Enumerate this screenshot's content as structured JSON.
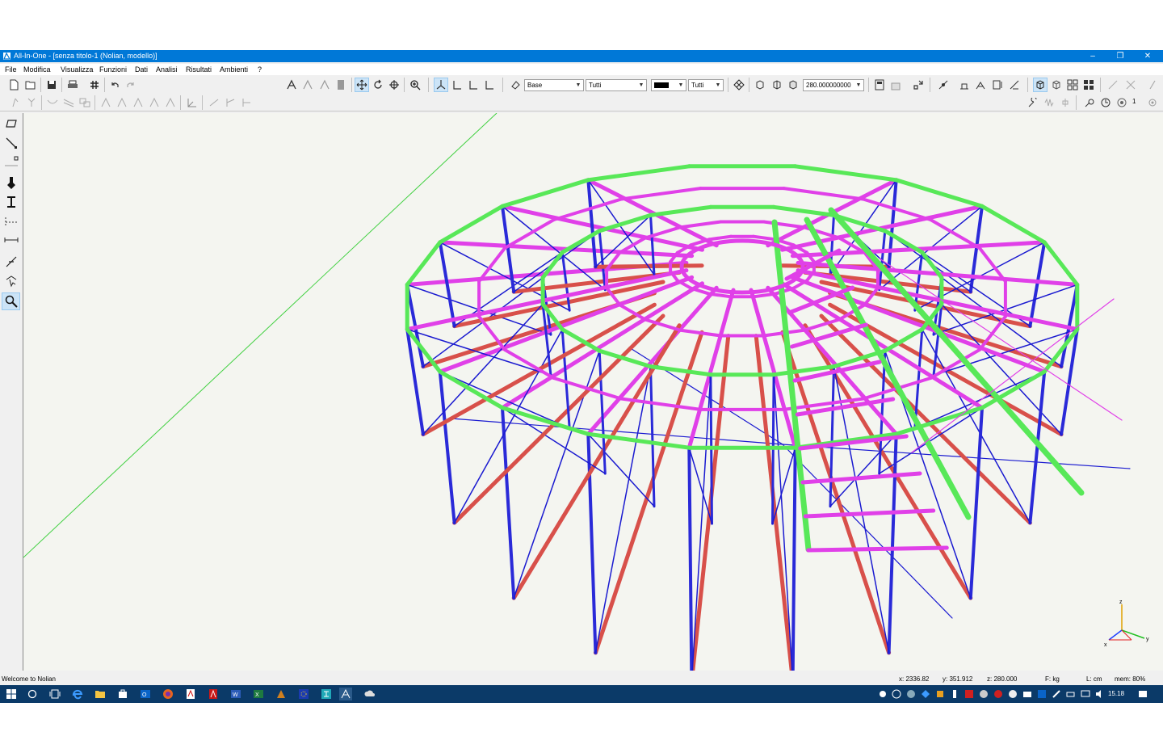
{
  "window": {
    "title": "All-In-One - [senza titolo-1 (Nolian, modello)]",
    "minimize": "‒",
    "restore": "❐",
    "close": "✕"
  },
  "menu": [
    "File",
    "Modifica",
    "Visualizza",
    "Funzioni",
    "Dati",
    "Analisi",
    "Risultati",
    "Ambienti",
    "?"
  ],
  "toolbar": {
    "layer_select": "Base",
    "filter_select": "Tutti",
    "color_select": "",
    "filter2_select": "Tutti",
    "number_field": "280.000000000",
    "layer_count": "1"
  },
  "colors": {
    "titlebar": "#0078d7",
    "taskbar": "#0b3a68",
    "member_magenta": "#e040e8",
    "member_blue": "#2a2ad8",
    "member_red": "#d8504a",
    "member_green": "#58e858",
    "bracing_blue": "#1a1ad0",
    "guide_line": "#40d040"
  },
  "axis_gizmo": {
    "z": "z",
    "x": "x",
    "y": "y"
  },
  "status": {
    "message": "Welcome to Nolian",
    "x": "x: 2336.82",
    "y": "y: 351.912",
    "z": "z: 280.000",
    "force_unit": "F: kg",
    "length_unit": "L: cm",
    "memory": "mem: 80%"
  },
  "taskbar": {
    "clock": "15.18"
  }
}
